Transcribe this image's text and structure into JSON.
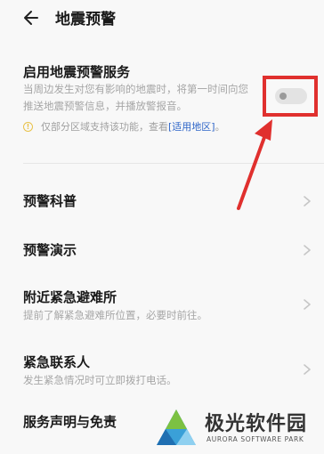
{
  "header": {
    "title": "地震预警"
  },
  "service": {
    "title": "启用地震预警服务",
    "description": "当周边发生对您有影响的地震时，将第一时间向您推送地震预警信息，并播放警报音。",
    "toggle_on": false,
    "note_text": "仅部分区域支持该功能，查看",
    "note_link": "[适用地区]",
    "note_end": "。"
  },
  "list": [
    {
      "title": "预警科普",
      "subtitle": ""
    },
    {
      "title": "预警演示",
      "subtitle": ""
    },
    {
      "title": "附近紧急避难所",
      "subtitle": "提前了解紧急避难所位置，必要时前往。"
    },
    {
      "title": "紧急联系人",
      "subtitle": "发生紧急情况时可立即拨打电话。"
    },
    {
      "title": "服务声明与免责",
      "subtitle": ""
    }
  ],
  "watermark": {
    "title": "极光软件园",
    "subtitle": "AURORA SOFTWARE PARK"
  },
  "colors": {
    "highlight": "#e0302e",
    "link": "#2f66c8",
    "info": "#e8c24a"
  }
}
